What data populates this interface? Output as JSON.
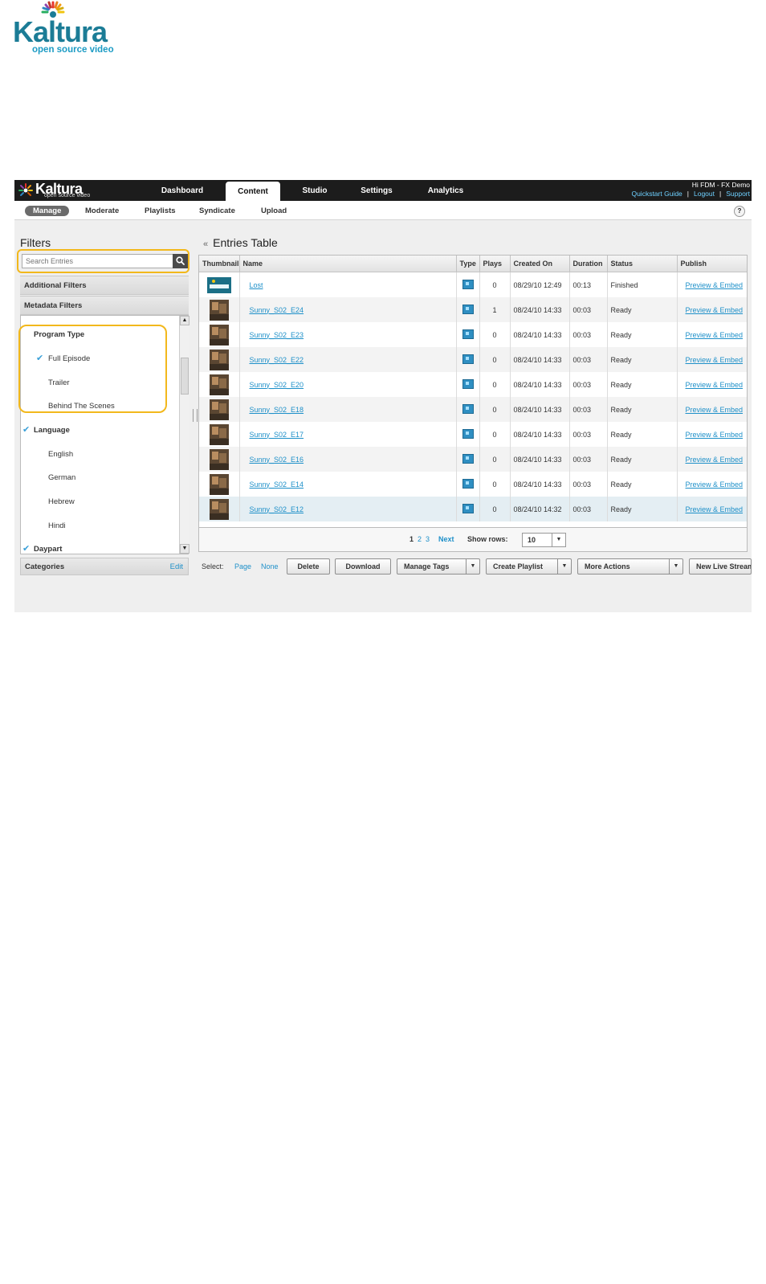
{
  "doc_logo": {
    "name": "Kaltura",
    "tagline": "open source video"
  },
  "app": {
    "logo": {
      "name": "Kaltura",
      "tagline": "open source video"
    },
    "nav_tabs": [
      {
        "label": "Dashboard",
        "active": false
      },
      {
        "label": "Content",
        "active": true
      },
      {
        "label": "Studio",
        "active": false
      },
      {
        "label": "Settings",
        "active": false
      },
      {
        "label": "Analytics",
        "active": false
      }
    ],
    "user": {
      "greeting": "Hi FDM - FX Demo",
      "links": [
        "Quickstart Guide",
        "Logout",
        "Support"
      ],
      "separator": "|"
    },
    "sub_tabs": [
      {
        "label": "Manage",
        "active": true
      },
      {
        "label": "Moderate",
        "active": false
      },
      {
        "label": "Playlists",
        "active": false
      },
      {
        "label": "Syndicate",
        "active": false
      },
      {
        "label": "Upload",
        "active": false
      }
    ],
    "help_label": "?"
  },
  "filters": {
    "title": "Filters",
    "search_placeholder": "Search Entries",
    "additional_filters": "Additional Filters",
    "metadata_filters": "Metadata Filters",
    "tree": [
      {
        "label": "Program Type",
        "group": true,
        "checked": false
      },
      {
        "label": "Full Episode",
        "group": false,
        "checked": true
      },
      {
        "label": "Trailer",
        "group": false,
        "checked": false
      },
      {
        "label": "Behind The Scenes",
        "group": false,
        "checked": false
      },
      {
        "label": "Language",
        "group": true,
        "checked": true
      },
      {
        "label": "English",
        "group": false,
        "checked": false
      },
      {
        "label": "German",
        "group": false,
        "checked": false
      },
      {
        "label": "Hebrew",
        "group": false,
        "checked": false
      },
      {
        "label": "Hindi",
        "group": false,
        "checked": false
      },
      {
        "label": "Daypart",
        "group": true,
        "checked": true
      }
    ],
    "categories": {
      "label": "Categories",
      "edit": "Edit"
    }
  },
  "entries": {
    "title": "Entries Table",
    "collapse_icon": "«",
    "columns": [
      "Thumbnail",
      "Name",
      "Type",
      "Plays",
      "Created On",
      "Duration",
      "Status",
      "Publish"
    ],
    "rows": [
      {
        "name": "Lost",
        "plays": "0",
        "created": "08/29/10 12:49",
        "duration": "00:13",
        "status": "Finished",
        "publish": "Preview & Embed",
        "thumb": "logo"
      },
      {
        "name": "Sunny_S02_E24",
        "plays": "1",
        "created": "08/24/10 14:33",
        "duration": "00:03",
        "status": "Ready",
        "publish": "Preview & Embed",
        "thumb": "photo"
      },
      {
        "name": "Sunny_S02_E23",
        "plays": "0",
        "created": "08/24/10 14:33",
        "duration": "00:03",
        "status": "Ready",
        "publish": "Preview & Embed",
        "thumb": "photo"
      },
      {
        "name": "Sunny_S02_E22",
        "plays": "0",
        "created": "08/24/10 14:33",
        "duration": "00:03",
        "status": "Ready",
        "publish": "Preview & Embed",
        "thumb": "photo"
      },
      {
        "name": "Sunny_S02_E20",
        "plays": "0",
        "created": "08/24/10 14:33",
        "duration": "00:03",
        "status": "Ready",
        "publish": "Preview & Embed",
        "thumb": "photo"
      },
      {
        "name": "Sunny_S02_E18",
        "plays": "0",
        "created": "08/24/10 14:33",
        "duration": "00:03",
        "status": "Ready",
        "publish": "Preview & Embed",
        "thumb": "photo"
      },
      {
        "name": "Sunny_S02_E17",
        "plays": "0",
        "created": "08/24/10 14:33",
        "duration": "00:03",
        "status": "Ready",
        "publish": "Preview & Embed",
        "thumb": "photo"
      },
      {
        "name": "Sunny_S02_E16",
        "plays": "0",
        "created": "08/24/10 14:33",
        "duration": "00:03",
        "status": "Ready",
        "publish": "Preview & Embed",
        "thumb": "photo"
      },
      {
        "name": "Sunny_S02_E14",
        "plays": "0",
        "created": "08/24/10 14:33",
        "duration": "00:03",
        "status": "Ready",
        "publish": "Preview & Embed",
        "thumb": "photo"
      },
      {
        "name": "Sunny_S02_E12",
        "plays": "0",
        "created": "08/24/10 14:32",
        "duration": "00:03",
        "status": "Ready",
        "publish": "Preview & Embed",
        "thumb": "photo"
      }
    ],
    "pager": {
      "pages": [
        "1",
        "2",
        "3"
      ],
      "current": "1",
      "next": "Next",
      "show_rows_label": "Show rows:",
      "rows_value": "10"
    },
    "actions": {
      "select_label": "Select:",
      "page": "Page",
      "none": "None",
      "delete": "Delete",
      "download": "Download",
      "manage_tags": "Manage Tags",
      "create_playlist": "Create Playlist",
      "more_actions": "More Actions",
      "new_live_stream": "New Live Stream"
    }
  },
  "colors": {
    "highlight": "#f2b81c",
    "link": "#1e90c9",
    "brand": "#1b7c96",
    "topbar": "#1c1c1c"
  }
}
